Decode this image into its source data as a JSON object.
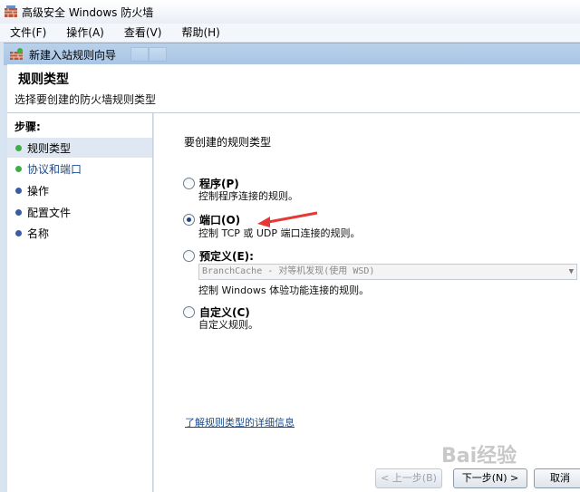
{
  "window": {
    "title": "高级安全 Windows 防火墙"
  },
  "menu": [
    "文件(F)",
    "操作(A)",
    "查看(V)",
    "帮助(H)"
  ],
  "wizard": {
    "title": "新建入站规则向导"
  },
  "header": {
    "title": "规则类型",
    "subtitle": "选择要创建的防火墙规则类型"
  },
  "steps": {
    "title": "步骤:",
    "items": [
      {
        "label": "规则类型",
        "color": "#3cb043"
      },
      {
        "label": "协议和端口",
        "color": "#3cb043"
      },
      {
        "label": "操作",
        "color": "#3b5ba8"
      },
      {
        "label": "配置文件",
        "color": "#3b5ba8"
      },
      {
        "label": "名称",
        "color": "#3b5ba8"
      }
    ]
  },
  "content": {
    "prompt": "要创建的规则类型",
    "options": [
      {
        "label": "程序(P)",
        "desc": "控制程序连接的规则。",
        "checked": false
      },
      {
        "label": "端口(O)",
        "desc": "控制 TCP 或 UDP 端口连接的规则。",
        "checked": true
      },
      {
        "label": "预定义(E):",
        "desc": "控制 Windows 体验功能连接的规则。",
        "checked": false
      },
      {
        "label": "自定义(C)",
        "desc": "自定义规则。",
        "checked": false
      }
    ],
    "predefined_select": "BranchCache - 对等机发现(使用 WSD)",
    "help_link": "了解规则类型的详细信息"
  },
  "buttons": {
    "back": "< 上一步(B)",
    "next": "下一步(N) >",
    "cancel": "取消"
  },
  "watermark": "Bai经验"
}
